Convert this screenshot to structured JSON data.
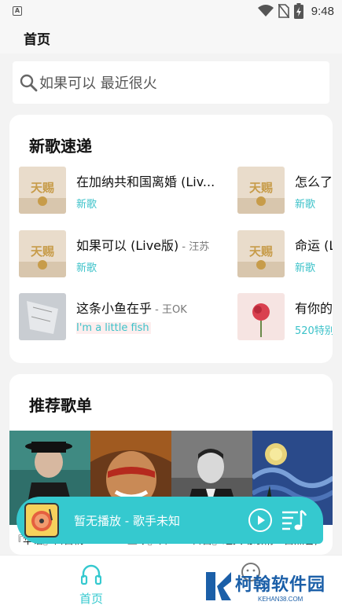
{
  "status_bar": {
    "time": "9:48",
    "app_icon_letter": "A",
    "icons": [
      "wifi-icon",
      "no-sim-icon",
      "battery-charging-icon"
    ]
  },
  "header": {
    "title": "首页"
  },
  "search": {
    "placeholder": "如果可以 最近很火"
  },
  "new_songs": {
    "title": "新歌速递",
    "songs": [
      {
        "title": "在加纳共和国离婚 (Liv...",
        "artist": "",
        "tag": "新歌",
        "cover": "show-cover"
      },
      {
        "title": "怎么了",
        "artist": "",
        "tag": "新歌",
        "cover": "show-cover"
      },
      {
        "title": "如果可以 (Live版)",
        "artist": " - 汪苏",
        "tag": "新歌",
        "cover": "show-cover"
      },
      {
        "title": "命运 (L",
        "artist": "",
        "tag": "新歌",
        "cover": "show-cover"
      },
      {
        "title": "这条小鱼在乎",
        "artist": " - 王OK",
        "tag": "I'm a little fish",
        "cover": "fish-cover"
      },
      {
        "title": "有你的",
        "artist": "",
        "tag": "520特别",
        "cover": "rose-cover"
      }
    ]
  },
  "recommend": {
    "title": "推荐歌单",
    "playlists_caption": "『华语』白首情 『1963-至今』日 『一日首』经典动眼精『自然音,"
  },
  "player": {
    "text": "暂无播放 - 歌手未知"
  },
  "bottom_nav": {
    "home_label": "首页"
  },
  "watermark": {
    "text": "柯翰软件园",
    "sub": "KEHAN38.COM"
  },
  "colors": {
    "accent": "#35c9cf",
    "tag": "#3cc2c9",
    "watermark": "#1b5fa8"
  }
}
